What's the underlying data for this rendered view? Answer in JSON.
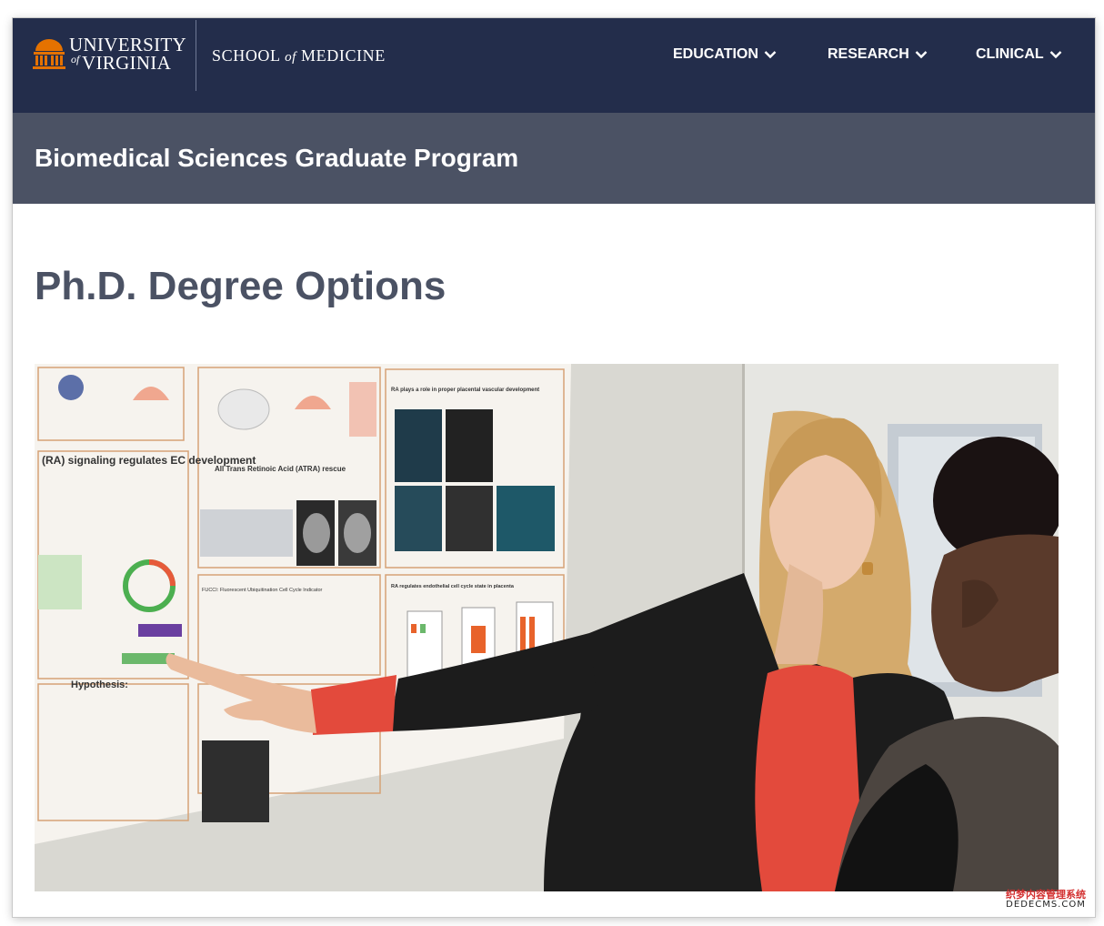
{
  "header": {
    "university_line1": "UNIVERSITY",
    "university_of": "of",
    "university_line2": "VIRGINIA",
    "school_prefix": "SCHOOL",
    "school_of": "of",
    "school_suffix": "MEDICINE",
    "nav": [
      {
        "label": "EDUCATION",
        "icon": "chevron-down-icon"
      },
      {
        "label": "RESEARCH",
        "icon": "chevron-down-icon"
      },
      {
        "label": "CLINICAL",
        "icon": "chevron-down-icon"
      }
    ]
  },
  "program_title": "Biomedical Sciences Graduate Program",
  "page_title": "Ph.D. Degree Options",
  "hero": {
    "poster_heading": "(RA) signaling regulates EC development",
    "poster_panels": [
      "RA plays a role in proper placental vascular development",
      "All Trans Retinoic Acid (ATRA) rescue",
      "FUCCI: Fluorescent Ubiquitination Cell Cycle Indicator",
      "RA regulates endothelial cell cycle state in placenta",
      "Hypothesis:"
    ]
  },
  "watermark": {
    "line1": "织梦内容管理系统",
    "line2": "DEDECMS.COM"
  },
  "colors": {
    "navy": "#232d4b",
    "slate": "#4b5264",
    "orange": "#e57200",
    "shirt": "#e34a3c"
  }
}
